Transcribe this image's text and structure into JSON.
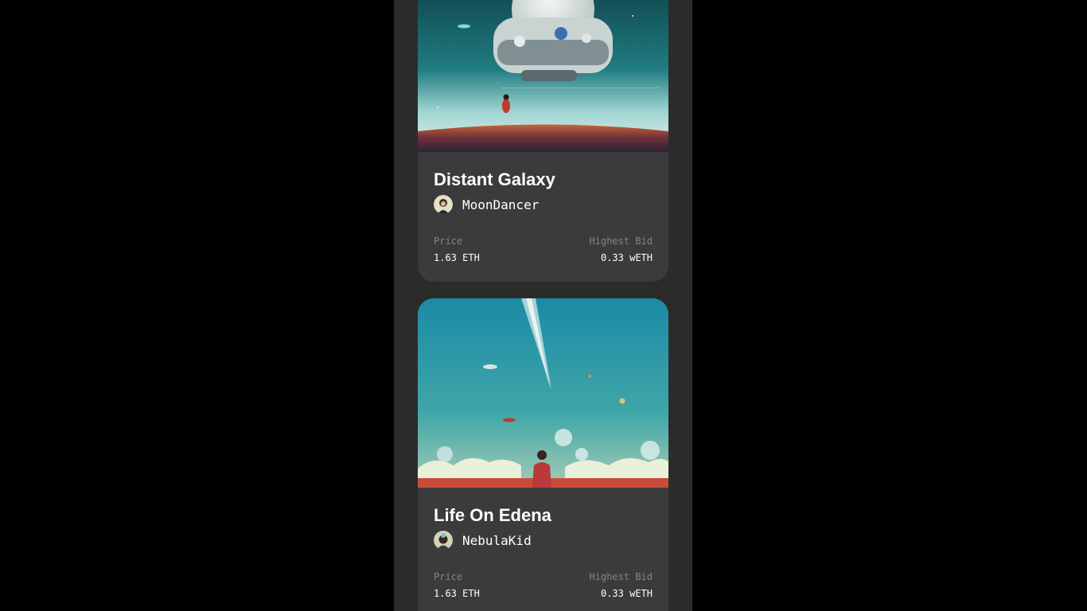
{
  "cards": [
    {
      "title": "Distant Galaxy",
      "artist": "MoonDancer",
      "price_label": "Price",
      "price": "1.63 ETH",
      "bid_label": "Highest Bid",
      "bid": "0.33 wETH",
      "image": "spaceship-over-planet-artwork"
    },
    {
      "title": "Life On Edena",
      "artist": "NebulaKid",
      "price_label": "Price",
      "price": "1.63 ETH",
      "bid_label": "Highest Bid",
      "bid": "0.33 wETH",
      "image": "figure-watching-teal-sky-artwork"
    }
  ],
  "colors": {
    "background": "#000000",
    "panel": "#2b2b2b",
    "card": "#3b3b3b",
    "muted_text": "#858584",
    "text": "#ffffff"
  }
}
